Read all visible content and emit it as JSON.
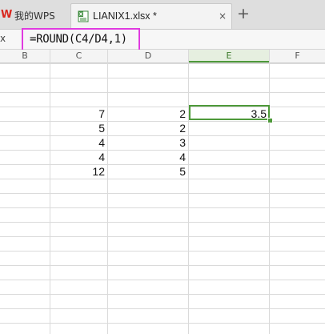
{
  "tabs": {
    "home_label": "我的WPS",
    "file_label": "LIANIX1.xlsx *",
    "close_glyph": "×",
    "add_glyph": "+"
  },
  "formula_bar": {
    "fx_label": "x",
    "formula": "=ROUND(C4/D4,1)",
    "highlight_color": "#e03be0"
  },
  "columns": [
    "B",
    "C",
    "D",
    "E",
    "F"
  ],
  "active_column": "E",
  "cells": {
    "C": [
      "7",
      "5",
      "4",
      "4",
      "12"
    ],
    "D": [
      "2",
      "2",
      "3",
      "4",
      "5"
    ],
    "E": [
      "3.5"
    ]
  },
  "colors": {
    "accent_green": "#4e9a3a",
    "wps_red": "#d9271e"
  }
}
